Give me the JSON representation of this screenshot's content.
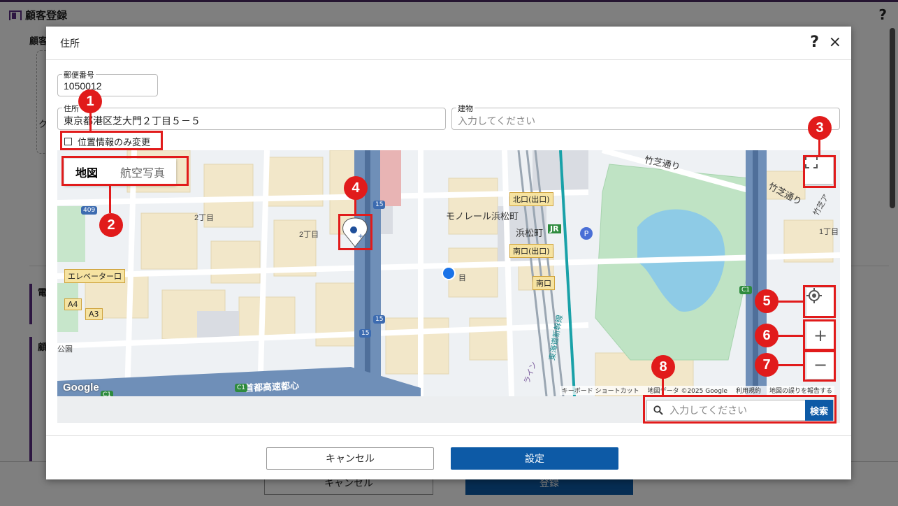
{
  "background": {
    "title": "顧客登録",
    "help": "?",
    "section_label": "顧客",
    "side_labels": [
      "電",
      "顧",
      "ク"
    ],
    "footer": {
      "cancel": "キャンセル",
      "register": "登録"
    }
  },
  "dialog": {
    "title": "住所",
    "help": "?",
    "close": "×",
    "postal": {
      "label": "郵便番号",
      "value": "1050012"
    },
    "address": {
      "label": "住所",
      "value": "東京都港区芝大門２丁目５－５"
    },
    "building": {
      "label": "建物",
      "placeholder": "入力してください"
    },
    "location_only": {
      "label": "位置情報のみ変更",
      "checked": false
    },
    "map": {
      "type_map": "地図",
      "type_aerial": "航空写真",
      "labels": {
        "takeshiba1": "竹芝通り",
        "takeshiba2": "竹芝通り",
        "takeshiba3": "竹芝ア",
        "chome1": "1丁目",
        "chome2a": "2丁目",
        "chome2b": "2丁目",
        "chome_partial": "目",
        "monorail": "モノレール浜松町",
        "hamamatsucho": "浜松町",
        "jr": "JR",
        "expressway": "首都高速都心",
        "tokaido": "東海道新幹線",
        "line": "ライン",
        "park_partial": "公園"
      },
      "badges": {
        "north_exit": "北口(出口)",
        "south_exit_exit": "南口(出口)",
        "south_exit": "南口",
        "elevator": "エレベーター口",
        "a4": "A4",
        "a3": "A3"
      },
      "road_numbers": {
        "r409": "409",
        "r15a": "15",
        "r15b": "15",
        "r15c": "15",
        "c1a": "C1",
        "c1b": "C1",
        "c1c": "C1"
      },
      "parking": "P",
      "google": "Google",
      "attribution": {
        "shortcuts": "キーボード ショートカット",
        "data": "地図データ ©2025 Google",
        "terms": "利用規約",
        "report": "地図の誤りを報告する"
      },
      "zoom_in": "+",
      "zoom_out": "−"
    },
    "search": {
      "placeholder": "入力してください",
      "button": "検索"
    },
    "buttons": {
      "cancel": "キャンセル",
      "set": "設定"
    }
  },
  "annotations": [
    "1",
    "2",
    "3",
    "4",
    "5",
    "6",
    "7",
    "8"
  ],
  "colors": {
    "accent": "#0d5aa6",
    "annotation": "#e11b1b",
    "brand": "#5a2d82"
  }
}
